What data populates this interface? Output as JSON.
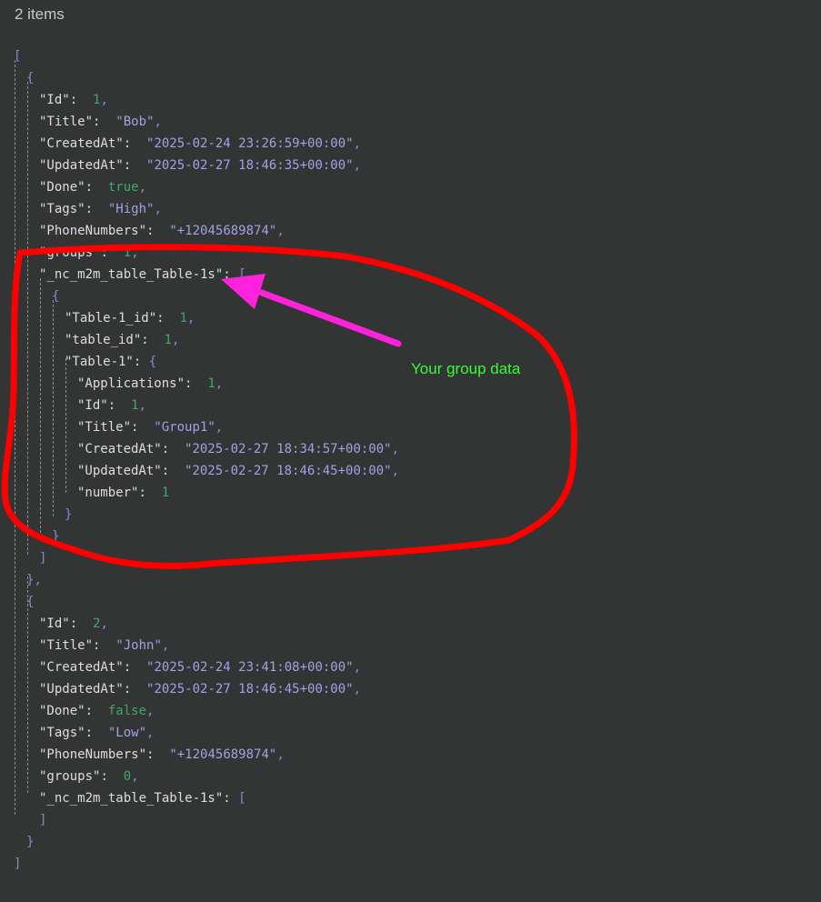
{
  "header": {
    "items_count": "2 items"
  },
  "json_view": {
    "lines": [
      [
        {
          "t": "[",
          "c": "punc"
        }
      ],
      [
        {
          "t": "{",
          "c": "punc"
        }
      ],
      [
        {
          "t": "\"Id\"",
          "c": "key"
        },
        {
          "t": ":  ",
          "c": "key"
        },
        {
          "t": "1",
          "c": "num"
        },
        {
          "t": ",",
          "c": "punc"
        }
      ],
      [
        {
          "t": "\"Title\"",
          "c": "key"
        },
        {
          "t": ":  ",
          "c": "key"
        },
        {
          "t": "\"Bob\"",
          "c": "str"
        },
        {
          "t": ",",
          "c": "punc"
        }
      ],
      [
        {
          "t": "\"CreatedAt\"",
          "c": "key"
        },
        {
          "t": ":  ",
          "c": "key"
        },
        {
          "t": "\"2025-02-24 23:26:59+00:00\"",
          "c": "str"
        },
        {
          "t": ",",
          "c": "punc"
        }
      ],
      [
        {
          "t": "\"UpdatedAt\"",
          "c": "key"
        },
        {
          "t": ":  ",
          "c": "key"
        },
        {
          "t": "\"2025-02-27 18:46:35+00:00\"",
          "c": "str"
        },
        {
          "t": ",",
          "c": "punc"
        }
      ],
      [
        {
          "t": "\"Done\"",
          "c": "key"
        },
        {
          "t": ":  ",
          "c": "key"
        },
        {
          "t": "true",
          "c": "bool"
        },
        {
          "t": ",",
          "c": "punc"
        }
      ],
      [
        {
          "t": "\"Tags\"",
          "c": "key"
        },
        {
          "t": ":  ",
          "c": "key"
        },
        {
          "t": "\"High\"",
          "c": "str"
        },
        {
          "t": ",",
          "c": "punc"
        }
      ],
      [
        {
          "t": "\"PhoneNumbers\"",
          "c": "key"
        },
        {
          "t": ":  ",
          "c": "key"
        },
        {
          "t": "\"+12045689874\"",
          "c": "str"
        },
        {
          "t": ",",
          "c": "punc"
        }
      ],
      [
        {
          "t": "\"groups\"",
          "c": "key"
        },
        {
          "t": ":  ",
          "c": "key"
        },
        {
          "t": "1",
          "c": "num"
        },
        {
          "t": ",",
          "c": "punc"
        }
      ],
      [
        {
          "t": "\"_nc_m2m_table_Table-1s\"",
          "c": "key"
        },
        {
          "t": ": ",
          "c": "key"
        },
        {
          "t": "[",
          "c": "punc"
        }
      ],
      [
        {
          "t": "{",
          "c": "punc"
        }
      ],
      [
        {
          "t": "\"Table-1_id\"",
          "c": "key"
        },
        {
          "t": ":  ",
          "c": "key"
        },
        {
          "t": "1",
          "c": "num"
        },
        {
          "t": ",",
          "c": "punc"
        }
      ],
      [
        {
          "t": "\"table_id\"",
          "c": "key"
        },
        {
          "t": ":  ",
          "c": "key"
        },
        {
          "t": "1",
          "c": "num"
        },
        {
          "t": ",",
          "c": "punc"
        }
      ],
      [
        {
          "t": "\"Table-1\"",
          "c": "key"
        },
        {
          "t": ": ",
          "c": "key"
        },
        {
          "t": "{",
          "c": "punc"
        }
      ],
      [
        {
          "t": "\"Applications\"",
          "c": "key"
        },
        {
          "t": ":  ",
          "c": "key"
        },
        {
          "t": "1",
          "c": "num"
        },
        {
          "t": ",",
          "c": "punc"
        }
      ],
      [
        {
          "t": "\"Id\"",
          "c": "key"
        },
        {
          "t": ":  ",
          "c": "key"
        },
        {
          "t": "1",
          "c": "num"
        },
        {
          "t": ",",
          "c": "punc"
        }
      ],
      [
        {
          "t": "\"Title\"",
          "c": "key"
        },
        {
          "t": ":  ",
          "c": "key"
        },
        {
          "t": "\"Group1\"",
          "c": "str"
        },
        {
          "t": ",",
          "c": "punc"
        }
      ],
      [
        {
          "t": "\"CreatedAt\"",
          "c": "key"
        },
        {
          "t": ":  ",
          "c": "key"
        },
        {
          "t": "\"2025-02-27 18:34:57+00:00\"",
          "c": "str"
        },
        {
          "t": ",",
          "c": "punc"
        }
      ],
      [
        {
          "t": "\"UpdatedAt\"",
          "c": "key"
        },
        {
          "t": ":  ",
          "c": "key"
        },
        {
          "t": "\"2025-02-27 18:46:45+00:00\"",
          "c": "str"
        },
        {
          "t": ",",
          "c": "punc"
        }
      ],
      [
        {
          "t": "\"number\"",
          "c": "key"
        },
        {
          "t": ":  ",
          "c": "key"
        },
        {
          "t": "1",
          "c": "num"
        }
      ],
      [
        {
          "t": "}",
          "c": "punc"
        }
      ],
      [
        {
          "t": "}",
          "c": "punc"
        }
      ],
      [
        {
          "t": "]",
          "c": "punc"
        }
      ],
      [
        {
          "t": "}",
          "c": "punc"
        },
        {
          "t": ",",
          "c": "punc"
        }
      ],
      [
        {
          "t": "{",
          "c": "punc"
        }
      ],
      [
        {
          "t": "\"Id\"",
          "c": "key"
        },
        {
          "t": ":  ",
          "c": "key"
        },
        {
          "t": "2",
          "c": "num"
        },
        {
          "t": ",",
          "c": "punc"
        }
      ],
      [
        {
          "t": "\"Title\"",
          "c": "key"
        },
        {
          "t": ":  ",
          "c": "key"
        },
        {
          "t": "\"John\"",
          "c": "str"
        },
        {
          "t": ",",
          "c": "punc"
        }
      ],
      [
        {
          "t": "\"CreatedAt\"",
          "c": "key"
        },
        {
          "t": ":  ",
          "c": "key"
        },
        {
          "t": "\"2025-02-24 23:41:08+00:00\"",
          "c": "str"
        },
        {
          "t": ",",
          "c": "punc"
        }
      ],
      [
        {
          "t": "\"UpdatedAt\"",
          "c": "key"
        },
        {
          "t": ":  ",
          "c": "key"
        },
        {
          "t": "\"2025-02-27 18:46:45+00:00\"",
          "c": "str"
        },
        {
          "t": ",",
          "c": "punc"
        }
      ],
      [
        {
          "t": "\"Done\"",
          "c": "key"
        },
        {
          "t": ":  ",
          "c": "key"
        },
        {
          "t": "false",
          "c": "bool"
        },
        {
          "t": ",",
          "c": "punc"
        }
      ],
      [
        {
          "t": "\"Tags\"",
          "c": "key"
        },
        {
          "t": ":  ",
          "c": "key"
        },
        {
          "t": "\"Low\"",
          "c": "str"
        },
        {
          "t": ",",
          "c": "punc"
        }
      ],
      [
        {
          "t": "\"PhoneNumbers\"",
          "c": "key"
        },
        {
          "t": ":  ",
          "c": "key"
        },
        {
          "t": "\"+12045689874\"",
          "c": "str"
        },
        {
          "t": ",",
          "c": "punc"
        }
      ],
      [
        {
          "t": "\"groups\"",
          "c": "key"
        },
        {
          "t": ":  ",
          "c": "key"
        },
        {
          "t": "0",
          "c": "num"
        },
        {
          "t": ",",
          "c": "punc"
        }
      ],
      [
        {
          "t": "\"_nc_m2m_table_Table-1s\"",
          "c": "key"
        },
        {
          "t": ": ",
          "c": "key"
        },
        {
          "t": "[",
          "c": "punc"
        }
      ],
      [
        {
          "t": "]",
          "c": "punc"
        }
      ],
      [
        {
          "t": "}",
          "c": "punc"
        }
      ],
      [
        {
          "t": "]",
          "c": "punc"
        }
      ]
    ]
  },
  "annotation": {
    "label": "Your group data",
    "circle_color": "#ff0000",
    "arrow_color": "#ff22dd",
    "label_color": "#33ff33"
  },
  "colors": {
    "background": "#333434",
    "key": "#dedede",
    "string": "#a6a0e3",
    "number": "#3fa86b",
    "punctuation": "#8d86d3"
  }
}
